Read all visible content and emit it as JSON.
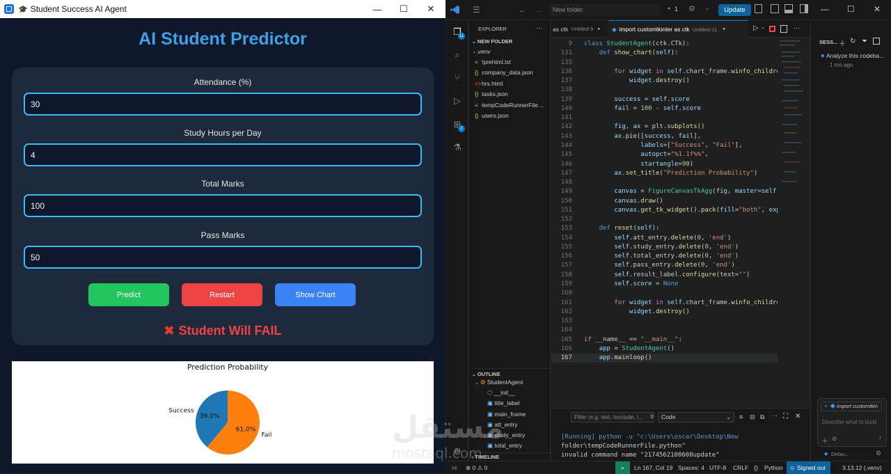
{
  "app": {
    "window_title": "Student Success AI Agent",
    "heading": "AI Student Predictor",
    "fields": [
      {
        "label": "Attendance (%)",
        "value": "30"
      },
      {
        "label": "Study Hours per Day",
        "value": "4"
      },
      {
        "label": "Total Marks",
        "value": "100"
      },
      {
        "label": "Pass Marks",
        "value": "50"
      }
    ],
    "buttons": {
      "predict": "Predict",
      "restart": "Restart",
      "show_chart": "Show Chart"
    },
    "result": "Student Will FAIL",
    "colors": {
      "predict": "#22c55e",
      "restart": "#ef4444",
      "show_chart": "#3b82f6",
      "accent": "#38bdf8"
    }
  },
  "chart_data": {
    "type": "pie",
    "title": "Prediction Probability",
    "labels": [
      "Success",
      "Fail"
    ],
    "values": [
      39.0,
      61.0
    ],
    "value_labels": [
      "39.0%",
      "61.0%"
    ],
    "colors": [
      "#1f77b4",
      "#ff7f0e"
    ],
    "startangle": 90
  },
  "vscode": {
    "search_placeholder": "New folder",
    "update_label": "Update",
    "count": "1",
    "explorer_title": "EXPLORER",
    "folder_title": "NEW FOLDER",
    "files": [
      ".venv",
      "!prehtml.txt",
      "company_data.json",
      "hrs.html",
      "tasks.json",
      "tempCodeRunnerFile....",
      "users.json"
    ],
    "tabs": [
      {
        "label": "as ctk",
        "sub": "Untitled-9"
      },
      {
        "label": "import customtkinter as ctk",
        "sub": "Untitled-11"
      }
    ],
    "code": [
      {
        "n": "9",
        "t": "class StudentAgent(ctk.CTk):"
      },
      {
        "n": "131",
        "t": "    def show_chart(self):"
      },
      {
        "n": "135",
        "t": ""
      },
      {
        "n": "136",
        "t": "        for widget in self.chart_frame.winfo_children():"
      },
      {
        "n": "137",
        "t": "            widget.destroy()"
      },
      {
        "n": "138",
        "t": ""
      },
      {
        "n": "139",
        "t": "        success = self.score"
      },
      {
        "n": "140",
        "t": "        fail = 100 - self.score"
      },
      {
        "n": "141",
        "t": ""
      },
      {
        "n": "142",
        "t": "        fig, ax = plt.subplots()"
      },
      {
        "n": "143",
        "t": "        ax.pie([success, fail],"
      },
      {
        "n": "144",
        "t": "               labels=[\"Success\", \"Fail\"],"
      },
      {
        "n": "145",
        "t": "               autopct=\"%1.1f%%\","
      },
      {
        "n": "146",
        "t": "               startangle=90)"
      },
      {
        "n": "147",
        "t": "        ax.set_title(\"Prediction Probability\")"
      },
      {
        "n": "148",
        "t": ""
      },
      {
        "n": "149",
        "t": "        canvas = FigureCanvasTkAgg(fig, master=self.chart_frame)"
      },
      {
        "n": "150",
        "t": "        canvas.draw()"
      },
      {
        "n": "151",
        "t": "        canvas.get_tk_widget().pack(fill=\"both\", expand=True)"
      },
      {
        "n": "152",
        "t": ""
      },
      {
        "n": "153",
        "t": "    def reset(self):"
      },
      {
        "n": "154",
        "t": "        self.att_entry.delete(0, 'end')"
      },
      {
        "n": "155",
        "t": "        self.study_entry.delete(0, 'end')"
      },
      {
        "n": "156",
        "t": "        self.total_entry.delete(0, 'end')"
      },
      {
        "n": "157",
        "t": "        self.pass_entry.delete(0, 'end')"
      },
      {
        "n": "158",
        "t": "        self.result_label.configure(text=\"\")"
      },
      {
        "n": "159",
        "t": "        self.score = None"
      },
      {
        "n": "160",
        "t": ""
      },
      {
        "n": "161",
        "t": "        for widget in self.chart_frame.winfo_children():"
      },
      {
        "n": "162",
        "t": "            widget.destroy()"
      },
      {
        "n": "163",
        "t": ""
      },
      {
        "n": "164",
        "t": ""
      },
      {
        "n": "165",
        "t": "if __name__ == \"__main__\":"
      },
      {
        "n": "166",
        "t": "    app = StudentAgent()"
      },
      {
        "n": "167",
        "t": "    app.mainloop()"
      }
    ],
    "outline_title": "OUTLINE",
    "outline": [
      "StudentAgent",
      "__init__",
      "title_label",
      "main_frame",
      "att_entry",
      "study_entry",
      "total_entry"
    ],
    "timeline": "TIMELINE",
    "panel": {
      "filter_placeholder": "Filter (e.g. text, !exclude, \\...",
      "dropdown": "Code",
      "lines": [
        "[Running] python -u \"c:\\Users\\oscar\\Desktop\\New",
        "folder\\tempCodeRunnerFile.python\"",
        "invalid command name \"2174562100608update\""
      ]
    },
    "chat": {
      "title": "SESS...",
      "item": "Analyze this codeba...",
      "item_time": "1 mo ago",
      "context": "import customtkin",
      "input_placeholder": "Describe what to build",
      "mode": "Defau..."
    },
    "status": {
      "errors": "0",
      "warnings": "0",
      "position": "Ln 167, Col 19",
      "spaces": "Spaces: 4",
      "encoding": "UTF-8",
      "eol": "CRLF",
      "language": "Python",
      "signed": "Signed out",
      "interpreter": "3.13.12 (.venv)"
    }
  },
  "watermark": {
    "arabic": "مستقل",
    "latin": "mostaql.com"
  }
}
